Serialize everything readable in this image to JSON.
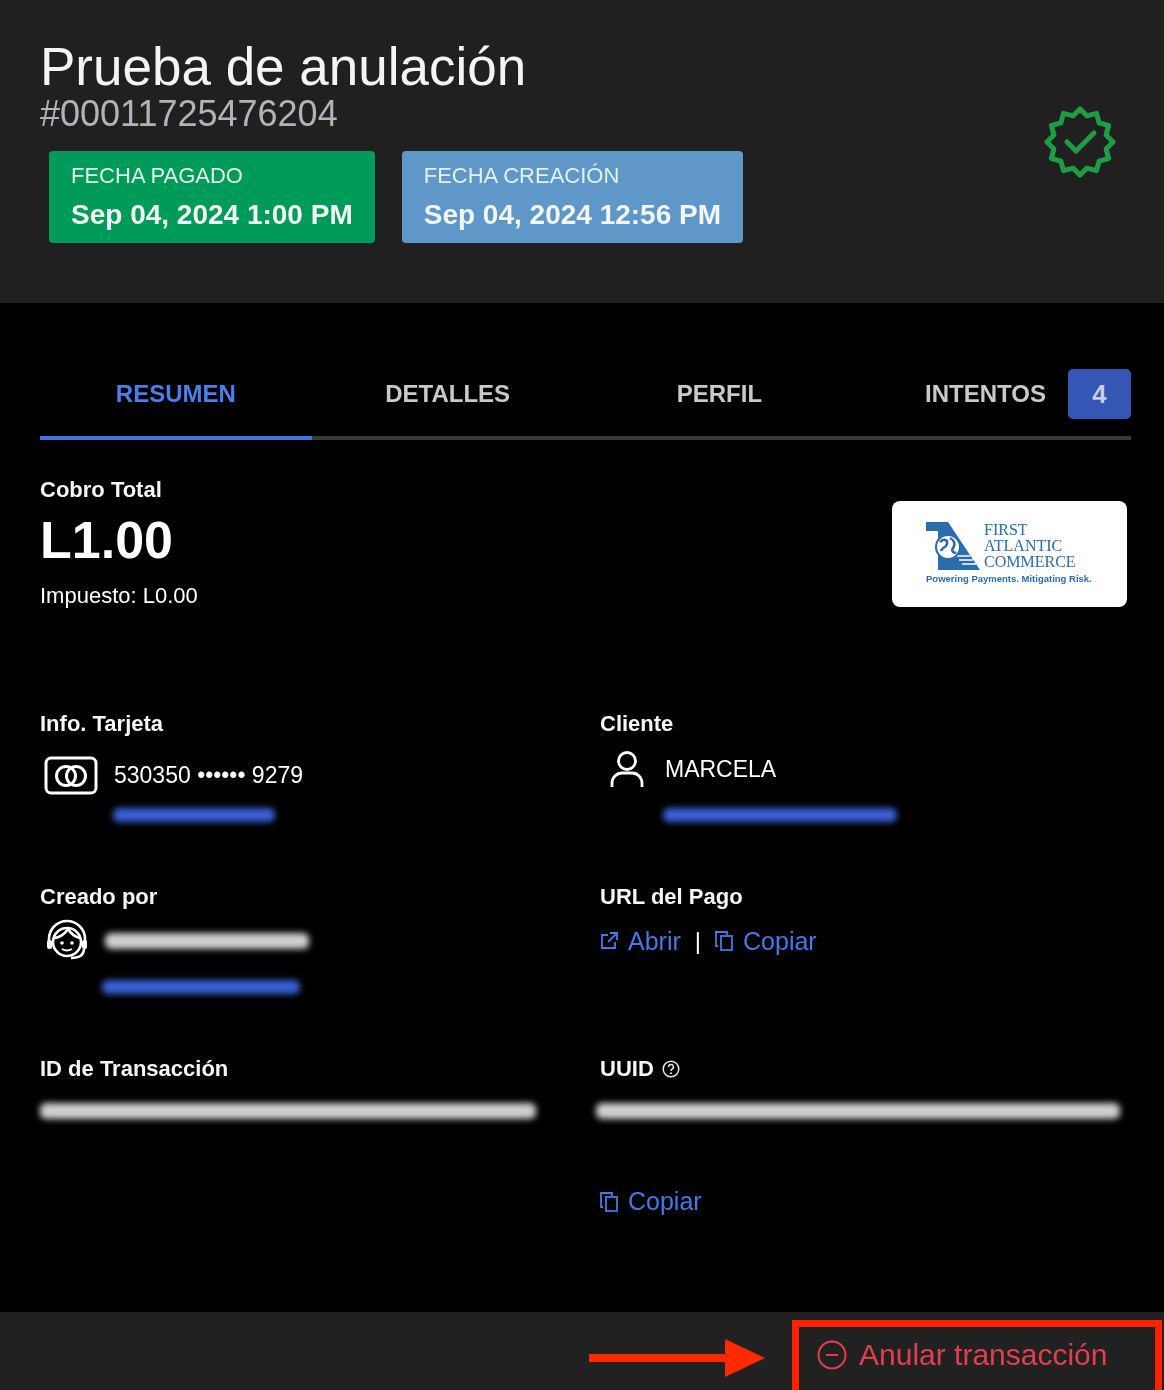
{
  "header": {
    "title": "Prueba de anulación",
    "reference": "#00011725476204",
    "verified": true,
    "date_chips": [
      {
        "label": "FECHA PAGADO",
        "value": "Sep 04, 2024 1:00 PM",
        "color": "#009a5a"
      },
      {
        "label": "FECHA CREACIÓN",
        "value": "Sep 04, 2024 12:56 PM",
        "color": "#5f97c9"
      }
    ]
  },
  "tabs": [
    {
      "label": "RESUMEN",
      "selected": true
    },
    {
      "label": "DETALLES",
      "selected": false
    },
    {
      "label": "PERFIL",
      "selected": false
    },
    {
      "label": "INTENTOS",
      "selected": false,
      "badge": "4"
    }
  ],
  "summary": {
    "title": "Cobro Total",
    "amount": "L1.00",
    "tax": "Impuesto: L0.00",
    "processor_logo": {
      "wordmark": [
        "FIRST",
        "ATLANTIC",
        "COMMERCE"
      ],
      "tagline": "Powering Payments. Mitigating Risk."
    }
  },
  "card_info": {
    "title": "Info. Tarjeta",
    "number": "530350 •••••• 9279",
    "redacted": [
      {
        "kind": "link"
      }
    ]
  },
  "client": {
    "title": "Cliente",
    "name": "MARCELA",
    "redacted": [
      {
        "kind": "link"
      }
    ]
  },
  "created_by": {
    "title": "Creado por",
    "redacted": [
      {
        "kind": "text"
      },
      {
        "kind": "link"
      }
    ]
  },
  "payment_url": {
    "title": "URL del Pago",
    "links": [
      {
        "kind": "open",
        "label": "Abrir"
      },
      {
        "kind": "copy",
        "label": "Copiar"
      }
    ],
    "separator": "|"
  },
  "transaction_id": {
    "title": "ID de Transacción",
    "redacted": [
      {
        "kind": "text"
      }
    ]
  },
  "uuid": {
    "title": "UUID",
    "help": true,
    "redacted": [
      {
        "kind": "text"
      }
    ],
    "copy_label": "Copiar"
  },
  "footer": {
    "void_button": {
      "label": "Anular transacción",
      "highlighted": true
    }
  }
}
